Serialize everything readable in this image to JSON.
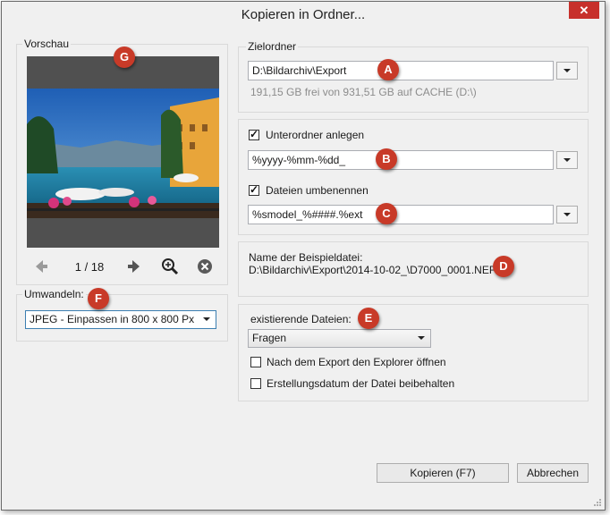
{
  "window": {
    "title": "Kopieren in Ordner...",
    "close_label": "✕"
  },
  "preview": {
    "label": "Vorschau",
    "counter": "1 / 18"
  },
  "convert": {
    "label": "Umwandeln:",
    "value": "JPEG - Einpassen in 800 x 800 Px"
  },
  "target": {
    "label": "Zielordner",
    "path": "D:\\Bildarchiv\\Export",
    "free_space": "191,15 GB frei von 931,51 GB auf CACHE (D:\\)"
  },
  "subfolder": {
    "checkbox_label": "Unterordner anlegen",
    "checked": true,
    "pattern": "%yyyy-%mm-%dd_"
  },
  "rename": {
    "checkbox_label": "Dateien umbenennen",
    "checked": true,
    "pattern": "%smodel_%####.%ext"
  },
  "example": {
    "label": "Name der Beispieldatei:",
    "value": "D:\\Bildarchiv\\Export\\2014-10-02_\\D7000_0001.NEF"
  },
  "existing": {
    "label": "existierende Dateien:",
    "value": "Fragen",
    "open_explorer_label": "Nach dem Export den Explorer öffnen",
    "open_explorer_checked": false,
    "keep_date_label": "Erstellungsdatum der Datei beibehalten",
    "keep_date_checked": false
  },
  "buttons": {
    "copy": "Kopieren (F7)",
    "cancel": "Abbrechen"
  },
  "badges": {
    "a": "A",
    "b": "B",
    "c": "C",
    "d": "D",
    "e": "E",
    "f": "F",
    "g": "G"
  },
  "colors": {
    "badge": "#c83a28",
    "close": "#c7302b",
    "select_border": "#3c7fb1"
  }
}
